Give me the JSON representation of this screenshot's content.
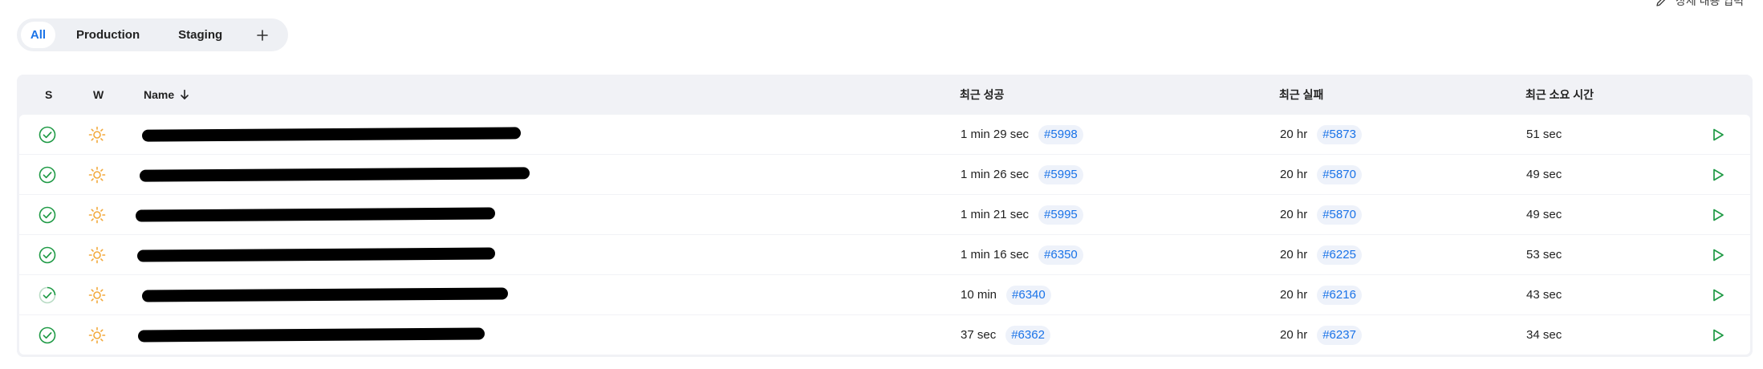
{
  "edit_link": {
    "label": "상세 내용 입력",
    "icon": "pencil-icon"
  },
  "tabs": [
    {
      "label": "All",
      "active": true
    },
    {
      "label": "Production",
      "active": false
    },
    {
      "label": "Staging",
      "active": false
    }
  ],
  "add_tab_icon": "plus-icon",
  "colors": {
    "accent": "#1a73e8",
    "success": "#1e9a45",
    "weather": "#f2a93b",
    "play": "#1e9a45"
  },
  "table": {
    "headers": {
      "status": "S",
      "weather": "W",
      "name": "Name",
      "last_success": "최근 성공",
      "last_failure": "최근 실패",
      "last_duration": "최근 소요 시간"
    },
    "rows": [
      {
        "status_icon": "success-check-icon",
        "weather_icon": "sun-icon",
        "name": "",
        "success_time": "1 min 29 sec",
        "success_build": "#5998",
        "failure_time": "20 hr",
        "failure_build": "#5873",
        "duration": "51 sec"
      },
      {
        "status_icon": "success-check-icon",
        "weather_icon": "sun-icon",
        "name": "",
        "success_time": "1 min 26 sec",
        "success_build": "#5995",
        "failure_time": "20 hr",
        "failure_build": "#5870",
        "duration": "49 sec"
      },
      {
        "status_icon": "success-check-icon",
        "weather_icon": "sun-icon",
        "name": "",
        "success_time": "1 min 21 sec",
        "success_build": "#5995",
        "failure_time": "20 hr",
        "failure_build": "#5870",
        "duration": "49 sec"
      },
      {
        "status_icon": "success-check-icon",
        "weather_icon": "sun-icon",
        "name": "",
        "success_time": "1 min 16 sec",
        "success_build": "#6350",
        "failure_time": "20 hr",
        "failure_build": "#6225",
        "duration": "53 sec"
      },
      {
        "status_icon": "in-progress-check-icon",
        "weather_icon": "sun-icon",
        "name": "",
        "success_time": "10 min",
        "success_build": "#6340",
        "failure_time": "20 hr",
        "failure_build": "#6216",
        "duration": "43 sec"
      },
      {
        "status_icon": "success-check-icon",
        "weather_icon": "sun-icon",
        "name": "",
        "success_time": "37 sec",
        "success_build": "#6362",
        "failure_time": "20 hr",
        "failure_build": "#6237",
        "duration": "34 sec"
      }
    ]
  }
}
